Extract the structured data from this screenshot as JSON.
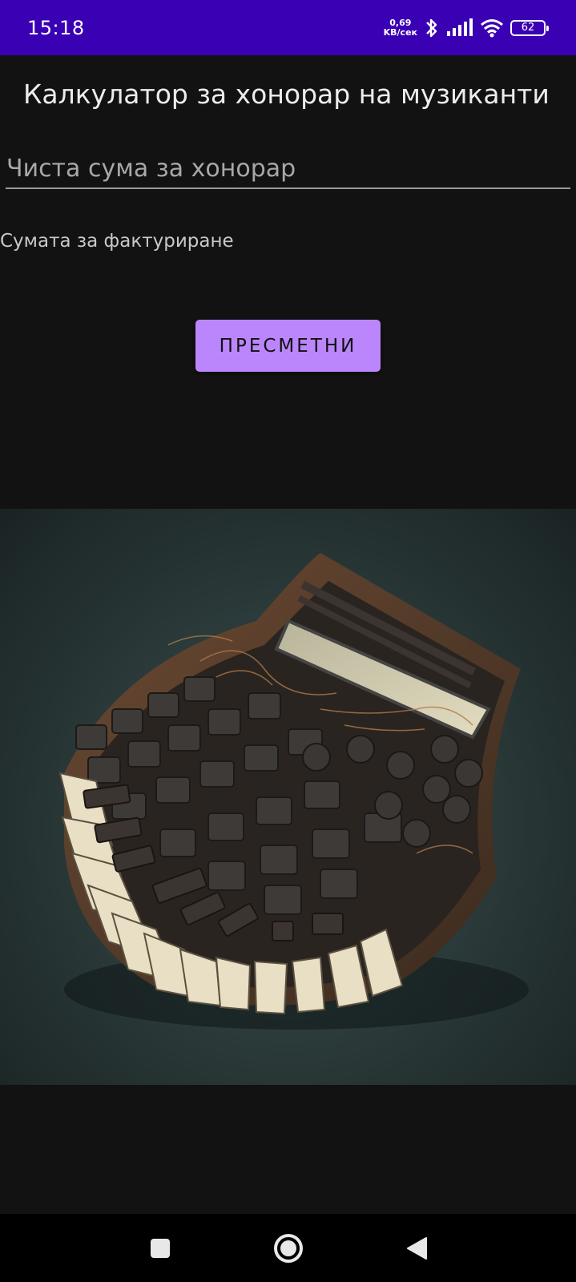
{
  "status_bar": {
    "time": "15:18",
    "net_speed_value": "0,69",
    "net_speed_unit": "KB/сек",
    "battery": "62",
    "icons": [
      "bluetooth-icon",
      "signal-icon",
      "wifi-icon",
      "battery-icon"
    ],
    "background": "#3a00b4"
  },
  "app": {
    "title": "Калкулатор за хонорар на музиканти",
    "input": {
      "placeholder": "Чиста сума за хонорар",
      "value": ""
    },
    "result_label": "Сумата за фактуриране",
    "calculate_button": "ПРЕСМЕТНИ",
    "accent": "#bb86fc",
    "image": "calculator-piano-illustration"
  },
  "nav_bar": {
    "buttons": [
      "recents-square-icon",
      "home-circle-icon",
      "back-triangle-icon"
    ]
  }
}
